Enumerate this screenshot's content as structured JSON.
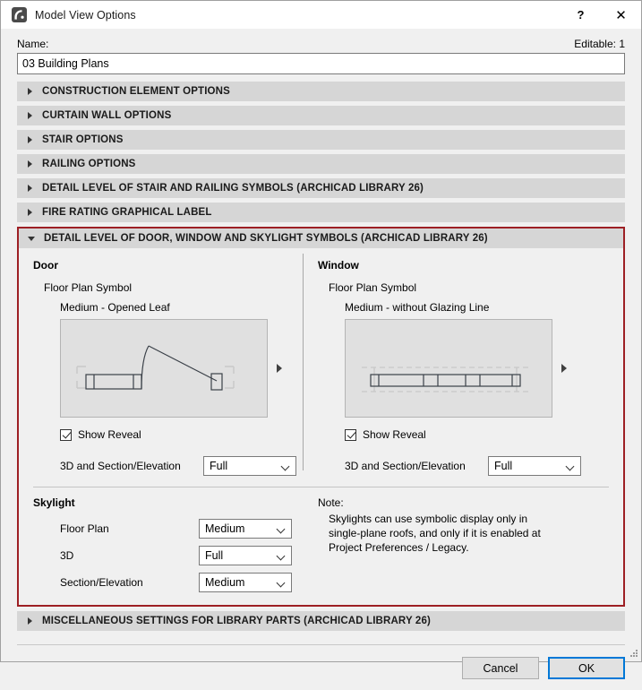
{
  "window": {
    "title": "Model View Options",
    "icon": "archicad-logo-icon",
    "help_label": "?",
    "close_label": "✕"
  },
  "name_row": {
    "label": "Name:",
    "editable": "Editable: 1",
    "value": "03 Building Plans",
    "placeholder": ""
  },
  "sections": [
    {
      "label": "CONSTRUCTION ELEMENT OPTIONS",
      "expanded": false
    },
    {
      "label": "CURTAIN WALL OPTIONS",
      "expanded": false
    },
    {
      "label": "STAIR OPTIONS",
      "expanded": false
    },
    {
      "label": "RAILING OPTIONS",
      "expanded": false
    },
    {
      "label": "DETAIL LEVEL OF STAIR AND RAILING SYMBOLS (ARCHICAD LIBRARY 26)",
      "expanded": false
    },
    {
      "label": "FIRE RATING GRAPHICAL LABEL",
      "expanded": false
    }
  ],
  "expanded_section": {
    "label": "DETAIL LEVEL OF DOOR, WINDOW AND SKYLIGHT SYMBOLS (ARCHICAD LIBRARY 26)",
    "highlight_color": "#9d1f24",
    "door": {
      "group_title": "Door",
      "sub_label": "Floor Plan Symbol",
      "preset": "Medium - Opened Leaf",
      "next_arrow": "next-arrow-icon",
      "show_reveal_label": "Show Reveal",
      "show_reveal_checked": true,
      "detail_label": "3D and Section/Elevation",
      "detail_value": "Full"
    },
    "window": {
      "group_title": "Window",
      "sub_label": "Floor Plan Symbol",
      "preset": "Medium - without Glazing Line",
      "next_arrow": "next-arrow-icon",
      "show_reveal_label": "Show Reveal",
      "show_reveal_checked": true,
      "detail_label": "3D and Section/Elevation",
      "detail_value": "Full"
    },
    "skylight": {
      "group_title": "Skylight",
      "fields": [
        {
          "label": "Floor Plan",
          "value": "Medium"
        },
        {
          "label": "3D",
          "value": "Full"
        },
        {
          "label": "Section/Elevation",
          "value": "Medium"
        }
      ]
    },
    "note": {
      "title": "Note:",
      "text": "Skylights can use symbolic display only in single-plane roofs, and only if it is enabled at Project Preferences / Legacy."
    }
  },
  "bottom_section": {
    "label": "MISCELLANEOUS SETTINGS FOR LIBRARY PARTS (ARCHICAD LIBRARY 26)",
    "expanded": false
  },
  "footer": {
    "cancel_label": "Cancel",
    "ok_label": "OK"
  }
}
